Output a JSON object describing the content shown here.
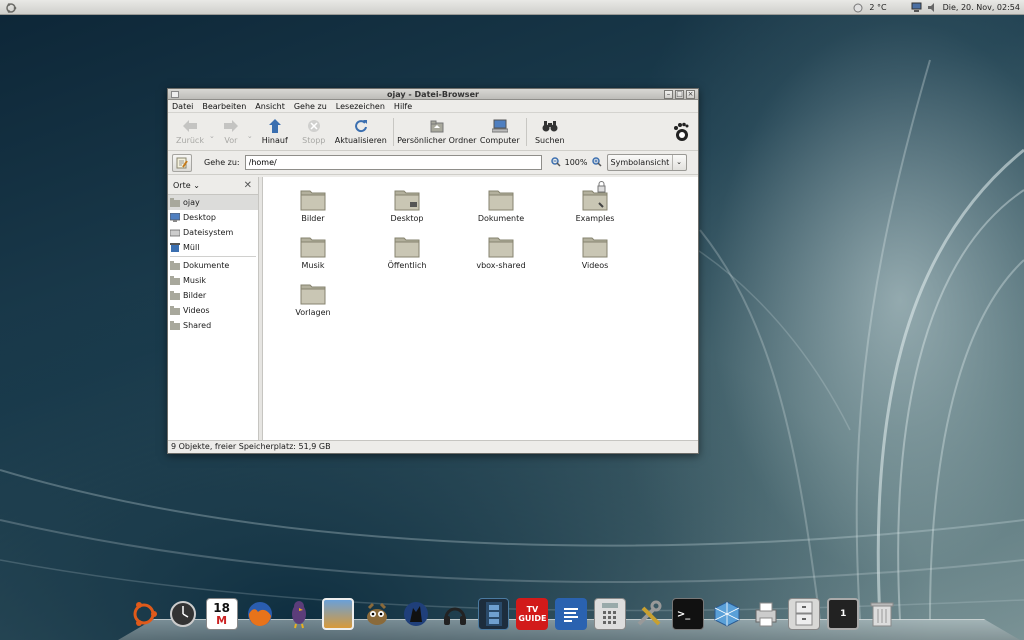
{
  "top_panel": {
    "weather": "2 °C",
    "clock": "Die, 20. Nov, 02:54",
    "icons": [
      "ubuntu-menu-icon",
      "weather-icon",
      "network-icon",
      "volume-icon"
    ]
  },
  "window": {
    "title": "ojay - Datei-Browser",
    "controls": [
      "minimize",
      "maximize",
      "close"
    ],
    "menu": [
      "Datei",
      "Bearbeiten",
      "Ansicht",
      "Gehe zu",
      "Lesezeichen",
      "Hilfe"
    ],
    "toolbar": {
      "back": "Zurück",
      "forward": "Vor",
      "up": "Hinauf",
      "stop": "Stopp",
      "reload": "Aktualisieren",
      "home": "Persönlicher Ordner",
      "computer": "Computer",
      "search": "Suchen"
    },
    "location": {
      "label": "Gehe zu:",
      "value": "/home/",
      "zoom": "100%",
      "view": "Symbolansicht"
    },
    "sidebar": {
      "header": "Orte",
      "places": [
        "ojay",
        "Desktop",
        "Dateisystem",
        "Müll"
      ],
      "bookmarks": [
        "Dokumente",
        "Musik",
        "Bilder",
        "Videos",
        "Shared"
      ]
    },
    "files": [
      "Bilder",
      "Desktop",
      "Dokumente",
      "Examples",
      "Musik",
      "Öffentlich",
      "vbox-shared",
      "Videos",
      "Vorlagen"
    ],
    "status": "9 Objekte, freier Speicherplatz: 51,9 GB"
  },
  "dock": {
    "items": [
      "ubuntu-icon",
      "clock-icon",
      "calendar-gmail-icon",
      "firefox-icon",
      "pidgin-icon",
      "photo-viewer-icon",
      "gimp-icon",
      "wolf-icon",
      "headphones-icon",
      "film-icon",
      "tv-guide-icon",
      "text-editor-icon",
      "calculator-icon",
      "tools-icon",
      "terminal-icon",
      "virtualbox-icon",
      "printer-icon",
      "file-cabinet-icon",
      "workspace-icon",
      "trash-icon"
    ],
    "calendar_day": "18",
    "tv_label": "TV GUIDE",
    "workspace_number": "1"
  },
  "colors": {
    "folder": "#c9c6b4",
    "folder_tab": "#b3b09d",
    "selection": "#dcdcda",
    "accent_blue": "#3b6fb0"
  }
}
